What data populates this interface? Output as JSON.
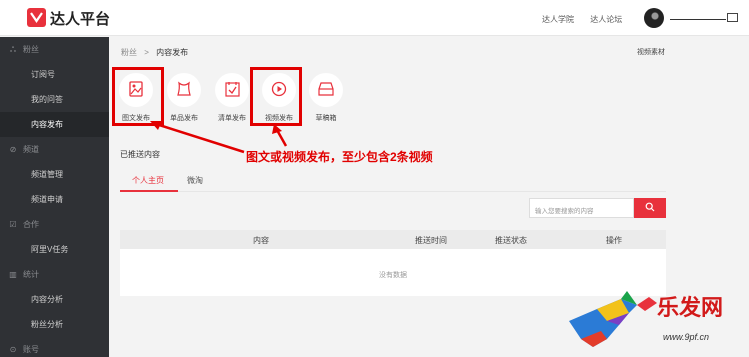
{
  "header": {
    "app_title": "达人平台",
    "links": [
      "达人学院",
      "达人论坛"
    ],
    "username": ""
  },
  "sidebar": {
    "groups": [
      {
        "icon": "fans-icon",
        "label": "粉丝",
        "items": [
          {
            "label": "订阅号",
            "active": false
          },
          {
            "label": "我的问答",
            "active": false
          },
          {
            "label": "内容发布",
            "active": true
          }
        ]
      },
      {
        "icon": "channel-icon",
        "label": "频道",
        "items": [
          {
            "label": "频道管理",
            "active": false
          },
          {
            "label": "频道申请",
            "active": false
          }
        ]
      },
      {
        "icon": "cooperation-icon",
        "label": "合作",
        "items": [
          {
            "label": "阿里V任务",
            "active": false
          }
        ]
      },
      {
        "icon": "stats-icon",
        "label": "统计",
        "items": [
          {
            "label": "内容分析",
            "active": false
          },
          {
            "label": "粉丝分析",
            "active": false
          }
        ]
      },
      {
        "icon": "account-icon",
        "label": "账号",
        "items": []
      }
    ]
  },
  "main": {
    "breadcrumb": {
      "parent": "粉丝",
      "separator": ">",
      "current": "内容发布"
    },
    "top_right_link": "视频素材",
    "tools": [
      {
        "label": "图文发布",
        "icon": "image-text-icon"
      },
      {
        "label": "单品发布",
        "icon": "single-item-icon"
      },
      {
        "label": "清单发布",
        "icon": "checklist-icon"
      },
      {
        "label": "视频发布",
        "icon": "video-play-icon"
      },
      {
        "label": "草稿箱",
        "icon": "drafts-icon"
      }
    ],
    "annotation": "图文或视频发布，至少包含2条视频",
    "section_title": "已推送内容",
    "tabs": [
      {
        "label": "个人主页",
        "active": true
      },
      {
        "label": "微淘",
        "active": false
      }
    ],
    "search": {
      "placeholder": "输入您要搜索的内容"
    },
    "table": {
      "columns": [
        "内容",
        "推送时间",
        "推送状态",
        "操作"
      ],
      "empty_text": "没有数据"
    }
  },
  "watermark": {
    "brand": "乐发网",
    "url": "www.9pf.cn"
  },
  "colors": {
    "accent": "#e8313c",
    "annotation_red": "#e10000",
    "sidebar_bg": "#2f3135"
  }
}
